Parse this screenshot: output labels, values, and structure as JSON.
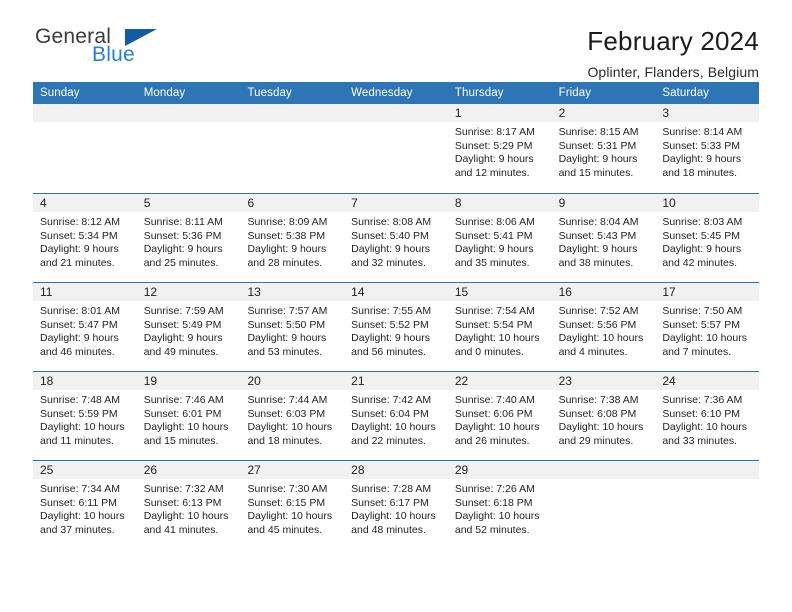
{
  "brand": {
    "name_top": "General",
    "name_bottom": "Blue",
    "color_top": "#3b3b3b",
    "color_bottom": "#2a7fd4",
    "triangle_color": "#135ca3"
  },
  "header": {
    "title": "February 2024",
    "location": "Oplinter, Flanders, Belgium"
  },
  "theme": {
    "header_bg": "#2e75b6",
    "header_text": "#ffffff",
    "daynum_strip_bg": "#f1f1f1",
    "row_divider": "#2e75b6"
  },
  "weekdays": [
    "Sunday",
    "Monday",
    "Tuesday",
    "Wednesday",
    "Thursday",
    "Friday",
    "Saturday"
  ],
  "weeks": [
    [
      {
        "day": "",
        "lines": []
      },
      {
        "day": "",
        "lines": []
      },
      {
        "day": "",
        "lines": []
      },
      {
        "day": "",
        "lines": []
      },
      {
        "day": "1",
        "lines": [
          "Sunrise: 8:17 AM",
          "Sunset: 5:29 PM",
          "Daylight: 9 hours",
          "and 12 minutes."
        ]
      },
      {
        "day": "2",
        "lines": [
          "Sunrise: 8:15 AM",
          "Sunset: 5:31 PM",
          "Daylight: 9 hours",
          "and 15 minutes."
        ]
      },
      {
        "day": "3",
        "lines": [
          "Sunrise: 8:14 AM",
          "Sunset: 5:33 PM",
          "Daylight: 9 hours",
          "and 18 minutes."
        ]
      }
    ],
    [
      {
        "day": "4",
        "lines": [
          "Sunrise: 8:12 AM",
          "Sunset: 5:34 PM",
          "Daylight: 9 hours",
          "and 21 minutes."
        ]
      },
      {
        "day": "5",
        "lines": [
          "Sunrise: 8:11 AM",
          "Sunset: 5:36 PM",
          "Daylight: 9 hours",
          "and 25 minutes."
        ]
      },
      {
        "day": "6",
        "lines": [
          "Sunrise: 8:09 AM",
          "Sunset: 5:38 PM",
          "Daylight: 9 hours",
          "and 28 minutes."
        ]
      },
      {
        "day": "7",
        "lines": [
          "Sunrise: 8:08 AM",
          "Sunset: 5:40 PM",
          "Daylight: 9 hours",
          "and 32 minutes."
        ]
      },
      {
        "day": "8",
        "lines": [
          "Sunrise: 8:06 AM",
          "Sunset: 5:41 PM",
          "Daylight: 9 hours",
          "and 35 minutes."
        ]
      },
      {
        "day": "9",
        "lines": [
          "Sunrise: 8:04 AM",
          "Sunset: 5:43 PM",
          "Daylight: 9 hours",
          "and 38 minutes."
        ]
      },
      {
        "day": "10",
        "lines": [
          "Sunrise: 8:03 AM",
          "Sunset: 5:45 PM",
          "Daylight: 9 hours",
          "and 42 minutes."
        ]
      }
    ],
    [
      {
        "day": "11",
        "lines": [
          "Sunrise: 8:01 AM",
          "Sunset: 5:47 PM",
          "Daylight: 9 hours",
          "and 46 minutes."
        ]
      },
      {
        "day": "12",
        "lines": [
          "Sunrise: 7:59 AM",
          "Sunset: 5:49 PM",
          "Daylight: 9 hours",
          "and 49 minutes."
        ]
      },
      {
        "day": "13",
        "lines": [
          "Sunrise: 7:57 AM",
          "Sunset: 5:50 PM",
          "Daylight: 9 hours",
          "and 53 minutes."
        ]
      },
      {
        "day": "14",
        "lines": [
          "Sunrise: 7:55 AM",
          "Sunset: 5:52 PM",
          "Daylight: 9 hours",
          "and 56 minutes."
        ]
      },
      {
        "day": "15",
        "lines": [
          "Sunrise: 7:54 AM",
          "Sunset: 5:54 PM",
          "Daylight: 10 hours",
          "and 0 minutes."
        ]
      },
      {
        "day": "16",
        "lines": [
          "Sunrise: 7:52 AM",
          "Sunset: 5:56 PM",
          "Daylight: 10 hours",
          "and 4 minutes."
        ]
      },
      {
        "day": "17",
        "lines": [
          "Sunrise: 7:50 AM",
          "Sunset: 5:57 PM",
          "Daylight: 10 hours",
          "and 7 minutes."
        ]
      }
    ],
    [
      {
        "day": "18",
        "lines": [
          "Sunrise: 7:48 AM",
          "Sunset: 5:59 PM",
          "Daylight: 10 hours",
          "and 11 minutes."
        ]
      },
      {
        "day": "19",
        "lines": [
          "Sunrise: 7:46 AM",
          "Sunset: 6:01 PM",
          "Daylight: 10 hours",
          "and 15 minutes."
        ]
      },
      {
        "day": "20",
        "lines": [
          "Sunrise: 7:44 AM",
          "Sunset: 6:03 PM",
          "Daylight: 10 hours",
          "and 18 minutes."
        ]
      },
      {
        "day": "21",
        "lines": [
          "Sunrise: 7:42 AM",
          "Sunset: 6:04 PM",
          "Daylight: 10 hours",
          "and 22 minutes."
        ]
      },
      {
        "day": "22",
        "lines": [
          "Sunrise: 7:40 AM",
          "Sunset: 6:06 PM",
          "Daylight: 10 hours",
          "and 26 minutes."
        ]
      },
      {
        "day": "23",
        "lines": [
          "Sunrise: 7:38 AM",
          "Sunset: 6:08 PM",
          "Daylight: 10 hours",
          "and 29 minutes."
        ]
      },
      {
        "day": "24",
        "lines": [
          "Sunrise: 7:36 AM",
          "Sunset: 6:10 PM",
          "Daylight: 10 hours",
          "and 33 minutes."
        ]
      }
    ],
    [
      {
        "day": "25",
        "lines": [
          "Sunrise: 7:34 AM",
          "Sunset: 6:11 PM",
          "Daylight: 10 hours",
          "and 37 minutes."
        ]
      },
      {
        "day": "26",
        "lines": [
          "Sunrise: 7:32 AM",
          "Sunset: 6:13 PM",
          "Daylight: 10 hours",
          "and 41 minutes."
        ]
      },
      {
        "day": "27",
        "lines": [
          "Sunrise: 7:30 AM",
          "Sunset: 6:15 PM",
          "Daylight: 10 hours",
          "and 45 minutes."
        ]
      },
      {
        "day": "28",
        "lines": [
          "Sunrise: 7:28 AM",
          "Sunset: 6:17 PM",
          "Daylight: 10 hours",
          "and 48 minutes."
        ]
      },
      {
        "day": "29",
        "lines": [
          "Sunrise: 7:26 AM",
          "Sunset: 6:18 PM",
          "Daylight: 10 hours",
          "and 52 minutes."
        ]
      },
      {
        "day": "",
        "lines": []
      },
      {
        "day": "",
        "lines": []
      }
    ]
  ]
}
